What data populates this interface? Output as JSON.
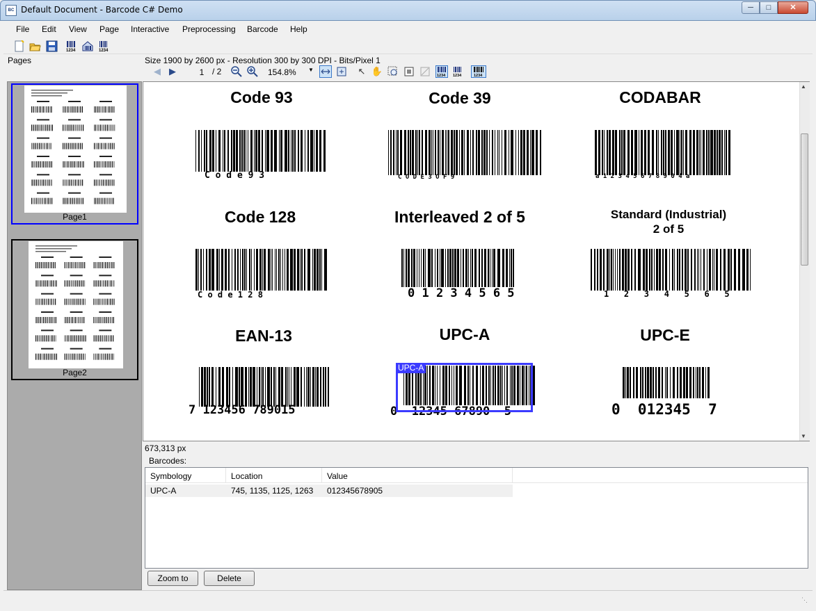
{
  "window": {
    "title": "Default Document - Barcode C# Demo",
    "icon": "app-icon",
    "controls": [
      "minimize",
      "maximize",
      "close"
    ]
  },
  "menu": [
    "File",
    "Edit",
    "View",
    "Page",
    "Interactive",
    "Preprocessing",
    "Barcode",
    "Help"
  ],
  "toolbar": {
    "icons": [
      "new-document-icon",
      "open-folder-icon",
      "save-icon",
      "read-barcode-1d-icon",
      "read-barcode-icon",
      "write-barcode-icon"
    ]
  },
  "pages_label": "Pages",
  "image_info": "Size 1900 by 2600 px - Resolution 300 by 300 DPI - Bits/Pixel 1",
  "nav": {
    "page": "1",
    "total": "/ 2",
    "zoom": "154.8%"
  },
  "thumbnails": [
    {
      "label": "Page1",
      "selected": true
    },
    {
      "label": "Page2",
      "selected": false
    }
  ],
  "barcodes_view": [
    {
      "title": "Code 93",
      "text": "C o d e   9 3"
    },
    {
      "title": "Code 39",
      "text": "C O D E   3   O F   9"
    },
    {
      "title": "CODABAR",
      "text": "a 1 2 3 4 5 6 7 8 9 0 4 a"
    },
    {
      "title": "Code 128",
      "text": "C o d e   1 2 8"
    },
    {
      "title": "Interleaved 2 of 5",
      "text": "0 1 2 3 4 5 6 5"
    },
    {
      "title": "Standard (Industrial)\n2 of 5",
      "text": "1   2   3   4   5   6   5"
    },
    {
      "title": "EAN-13",
      "text": "7 123456 789015"
    },
    {
      "title": "UPC-A",
      "text": "0  12345 67890  5"
    },
    {
      "title": "UPC-E",
      "text": "0  012345  7"
    }
  ],
  "detection_tag": "UPC-A",
  "coordinates": "673,313 px",
  "barcodes_group": "Barcodes:",
  "table": {
    "headers": [
      "Symbology",
      "Location",
      "Value"
    ],
    "rows": [
      {
        "symbology": "UPC-A",
        "location": "745, 1135, 1125, 1263",
        "value": "012345678905"
      }
    ]
  },
  "buttons": {
    "zoom": "Zoom to",
    "delete": "Delete"
  }
}
